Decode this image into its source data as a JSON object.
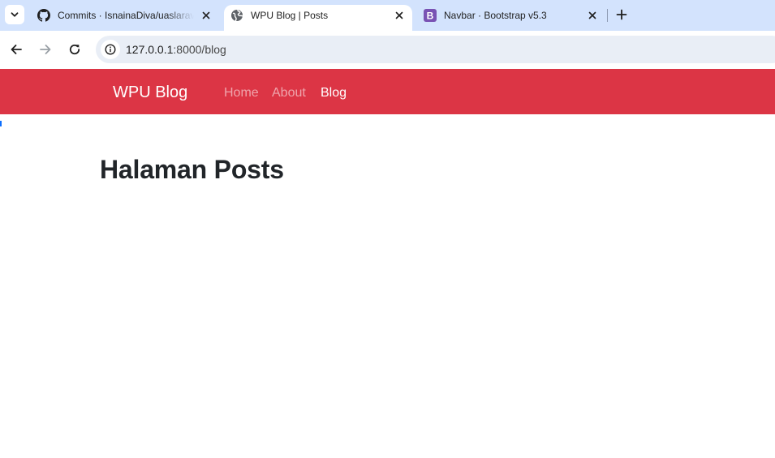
{
  "browser": {
    "tabs": [
      {
        "title": "Commits · IsnainaDiva/uaslaravel",
        "favicon": "github-icon"
      },
      {
        "title": "WPU Blog | Posts",
        "favicon": "globe-icon",
        "active": true
      },
      {
        "title": "Navbar · Bootstrap v5.3",
        "favicon": "bootstrap-icon",
        "favicon_letter": "B",
        "favicon_color": "#7952b3"
      }
    ],
    "url_host": "127.0.0.1",
    "url_rest": ":8000/blog",
    "accent": "#d3e3fd"
  },
  "site": {
    "brand": "WPU Blog",
    "nav": [
      {
        "label": "Home",
        "active": false
      },
      {
        "label": "About",
        "active": false
      },
      {
        "label": "Blog",
        "active": true
      }
    ],
    "navbar_color": "#dc3545"
  },
  "main": {
    "title": "Halaman Posts"
  }
}
